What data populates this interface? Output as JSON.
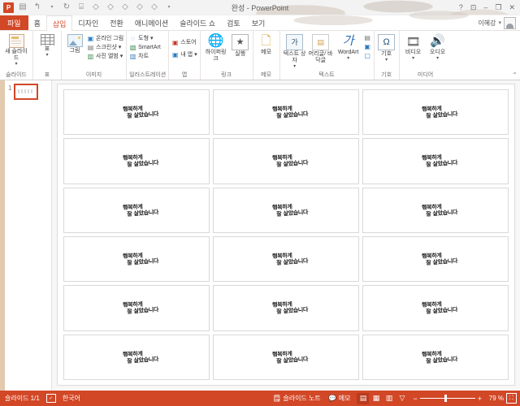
{
  "window": {
    "title": "완성 - PowerPoint",
    "help_icon": "?",
    "ribbon_display_icon": "ribbon-display-options-icon",
    "minimize_icon": "–",
    "restore_icon": "❐",
    "close_icon": "✕"
  },
  "quick_access": {
    "items": [
      {
        "name": "powerpoint-logo",
        "glyph": "P"
      },
      {
        "name": "save-icon",
        "glyph": "💾"
      },
      {
        "name": "undo-icon",
        "glyph": "↰"
      },
      {
        "name": "undo-dropdown-icon",
        "glyph": "▾"
      },
      {
        "name": "redo-icon",
        "glyph": "↻"
      },
      {
        "name": "start-slideshow-icon",
        "glyph": "🖵"
      },
      {
        "name": "disabled-icon-1",
        "glyph": "◇"
      },
      {
        "name": "disabled-icon-2",
        "glyph": "◇"
      },
      {
        "name": "disabled-icon-3",
        "glyph": "◇"
      },
      {
        "name": "disabled-icon-4",
        "glyph": "◇"
      },
      {
        "name": "disabled-icon-5",
        "glyph": "◇"
      },
      {
        "name": "customize-qat-icon",
        "glyph": "▾"
      }
    ]
  },
  "tabs": [
    {
      "label": "파일",
      "name": "tab-file",
      "kind": "file"
    },
    {
      "label": "홈",
      "name": "tab-home",
      "kind": "normal"
    },
    {
      "label": "삽입",
      "name": "tab-insert",
      "kind": "active"
    },
    {
      "label": "디자인",
      "name": "tab-design",
      "kind": "normal"
    },
    {
      "label": "전환",
      "name": "tab-transitions",
      "kind": "normal"
    },
    {
      "label": "애니메이션",
      "name": "tab-animations",
      "kind": "normal"
    },
    {
      "label": "슬라이드 쇼",
      "name": "tab-slideshow",
      "kind": "normal"
    },
    {
      "label": "검토",
      "name": "tab-review",
      "kind": "normal"
    },
    {
      "label": "보기",
      "name": "tab-view",
      "kind": "normal"
    }
  ],
  "account": {
    "user_name": "이혜강",
    "caret": "▾"
  },
  "ribbon": {
    "collapse_caret": "⌃",
    "groups": [
      {
        "label": "슬라이드",
        "big": [
          {
            "label": "새 슬라이드",
            "dropdown": "▾",
            "icon": "new-slide-icon"
          }
        ],
        "small": []
      },
      {
        "label": "표",
        "big": [
          {
            "label": "표",
            "dropdown": "▾",
            "icon": "table-icon"
          }
        ],
        "small": []
      },
      {
        "label": "이미지",
        "big": [
          {
            "label": "그림",
            "dropdown": "",
            "icon": "picture-icon"
          }
        ],
        "small": [
          {
            "label": "온라인 그림",
            "icon": "online-picture-icon",
            "glyph": "▣",
            "color": "sq-blue",
            "dropdown": ""
          },
          {
            "label": "스크린샷",
            "icon": "screenshot-icon",
            "glyph": "▤",
            "color": "sq-gray",
            "dropdown": "▾"
          },
          {
            "label": "사진 앨범",
            "icon": "photo-album-icon",
            "glyph": "▥",
            "color": "sq-green",
            "dropdown": "▾"
          }
        ]
      },
      {
        "label": "일러스트레이션",
        "big": [],
        "small": [
          {
            "label": "도형",
            "icon": "shapes-icon",
            "glyph": "◇",
            "color": "sq-blue",
            "dropdown": "▾"
          },
          {
            "label": "SmartArt",
            "icon": "smartart-icon",
            "glyph": "▧",
            "color": "sq-green",
            "dropdown": ""
          },
          {
            "label": "차트",
            "icon": "chart-icon",
            "glyph": "▥",
            "color": "sq-blue",
            "dropdown": ""
          }
        ]
      },
      {
        "label": "앱",
        "big": [],
        "small": [
          {
            "label": "스토어",
            "icon": "store-icon",
            "glyph": "▣",
            "color": "sq-red",
            "dropdown": ""
          },
          {
            "label": "내 앱",
            "icon": "my-apps-icon",
            "glyph": "▣",
            "color": "sq-blue",
            "dropdown": "▾"
          }
        ]
      },
      {
        "label": "링크",
        "big": [
          {
            "label": "하이퍼링크",
            "dropdown": "",
            "icon": "hyperlink-icon"
          },
          {
            "label": "실행",
            "dropdown": "",
            "icon": "action-icon"
          }
        ],
        "small": []
      },
      {
        "label": "메모",
        "big": [
          {
            "label": "메모",
            "dropdown": "",
            "icon": "comment-icon"
          }
        ],
        "small": []
      },
      {
        "label": "텍스트",
        "big": [
          {
            "label": "텍스트 상자",
            "dropdown": "▾",
            "icon": "text-box-icon"
          },
          {
            "label": "머리글/ 바닥글",
            "dropdown": "",
            "icon": "header-footer-icon"
          },
          {
            "label": "WordArt",
            "dropdown": "▾",
            "icon": "wordart-icon"
          }
        ],
        "small": [
          {
            "label": "",
            "icon": "date-time-icon",
            "glyph": "▤",
            "color": "sq-gray",
            "dropdown": ""
          },
          {
            "label": "",
            "icon": "slide-number-icon",
            "glyph": "▣",
            "color": "sq-blue",
            "dropdown": ""
          },
          {
            "label": "",
            "icon": "object-icon",
            "glyph": "▢",
            "color": "sq-blue",
            "dropdown": ""
          }
        ]
      },
      {
        "label": "기호",
        "big": [
          {
            "label": "기호",
            "dropdown": "▾",
            "icon": "symbol-icon"
          }
        ],
        "small": []
      },
      {
        "label": "미디어",
        "big": [
          {
            "label": "비디오",
            "dropdown": "▾",
            "icon": "video-icon"
          },
          {
            "label": "오디오",
            "dropdown": "▾",
            "icon": "audio-icon"
          }
        ],
        "small": []
      }
    ]
  },
  "slide_panel": {
    "slides": [
      {
        "number": "1",
        "name": "slide-thumbnail-1",
        "selected": true
      }
    ]
  },
  "slide": {
    "card_text_line1": "행복하게",
    "card_text_line2": "잘 살았습니다",
    "rows": 6,
    "columns": 3,
    "total_cards": 18
  },
  "status_bar": {
    "slide_count_label": "슬라이드 1/1",
    "language_label": "한국어",
    "language_icon": "spellcheck-icon",
    "notes_label": "슬라이드 노트",
    "notes_icon": "notes-icon",
    "comments_label": "메모",
    "comments_icon": "comments-icon",
    "views": [
      {
        "name": "view-normal",
        "glyph": "▤",
        "active": true
      },
      {
        "name": "view-slide-sorter",
        "glyph": "▦",
        "active": false
      },
      {
        "name": "view-reading",
        "glyph": "▥",
        "active": false
      },
      {
        "name": "view-slideshow",
        "glyph": "▽",
        "active": false
      }
    ],
    "zoom_minus": "−",
    "zoom_plus": "+",
    "zoom_level": "79 %",
    "fit_icon": "fit-to-window-icon",
    "fit_glyph": "⛶"
  },
  "colors": {
    "accent": "#d24726",
    "ribbon_bg": "#ffffff",
    "canvas_bg": "#f7f7f7",
    "left_rail": "#e3c9ae"
  }
}
